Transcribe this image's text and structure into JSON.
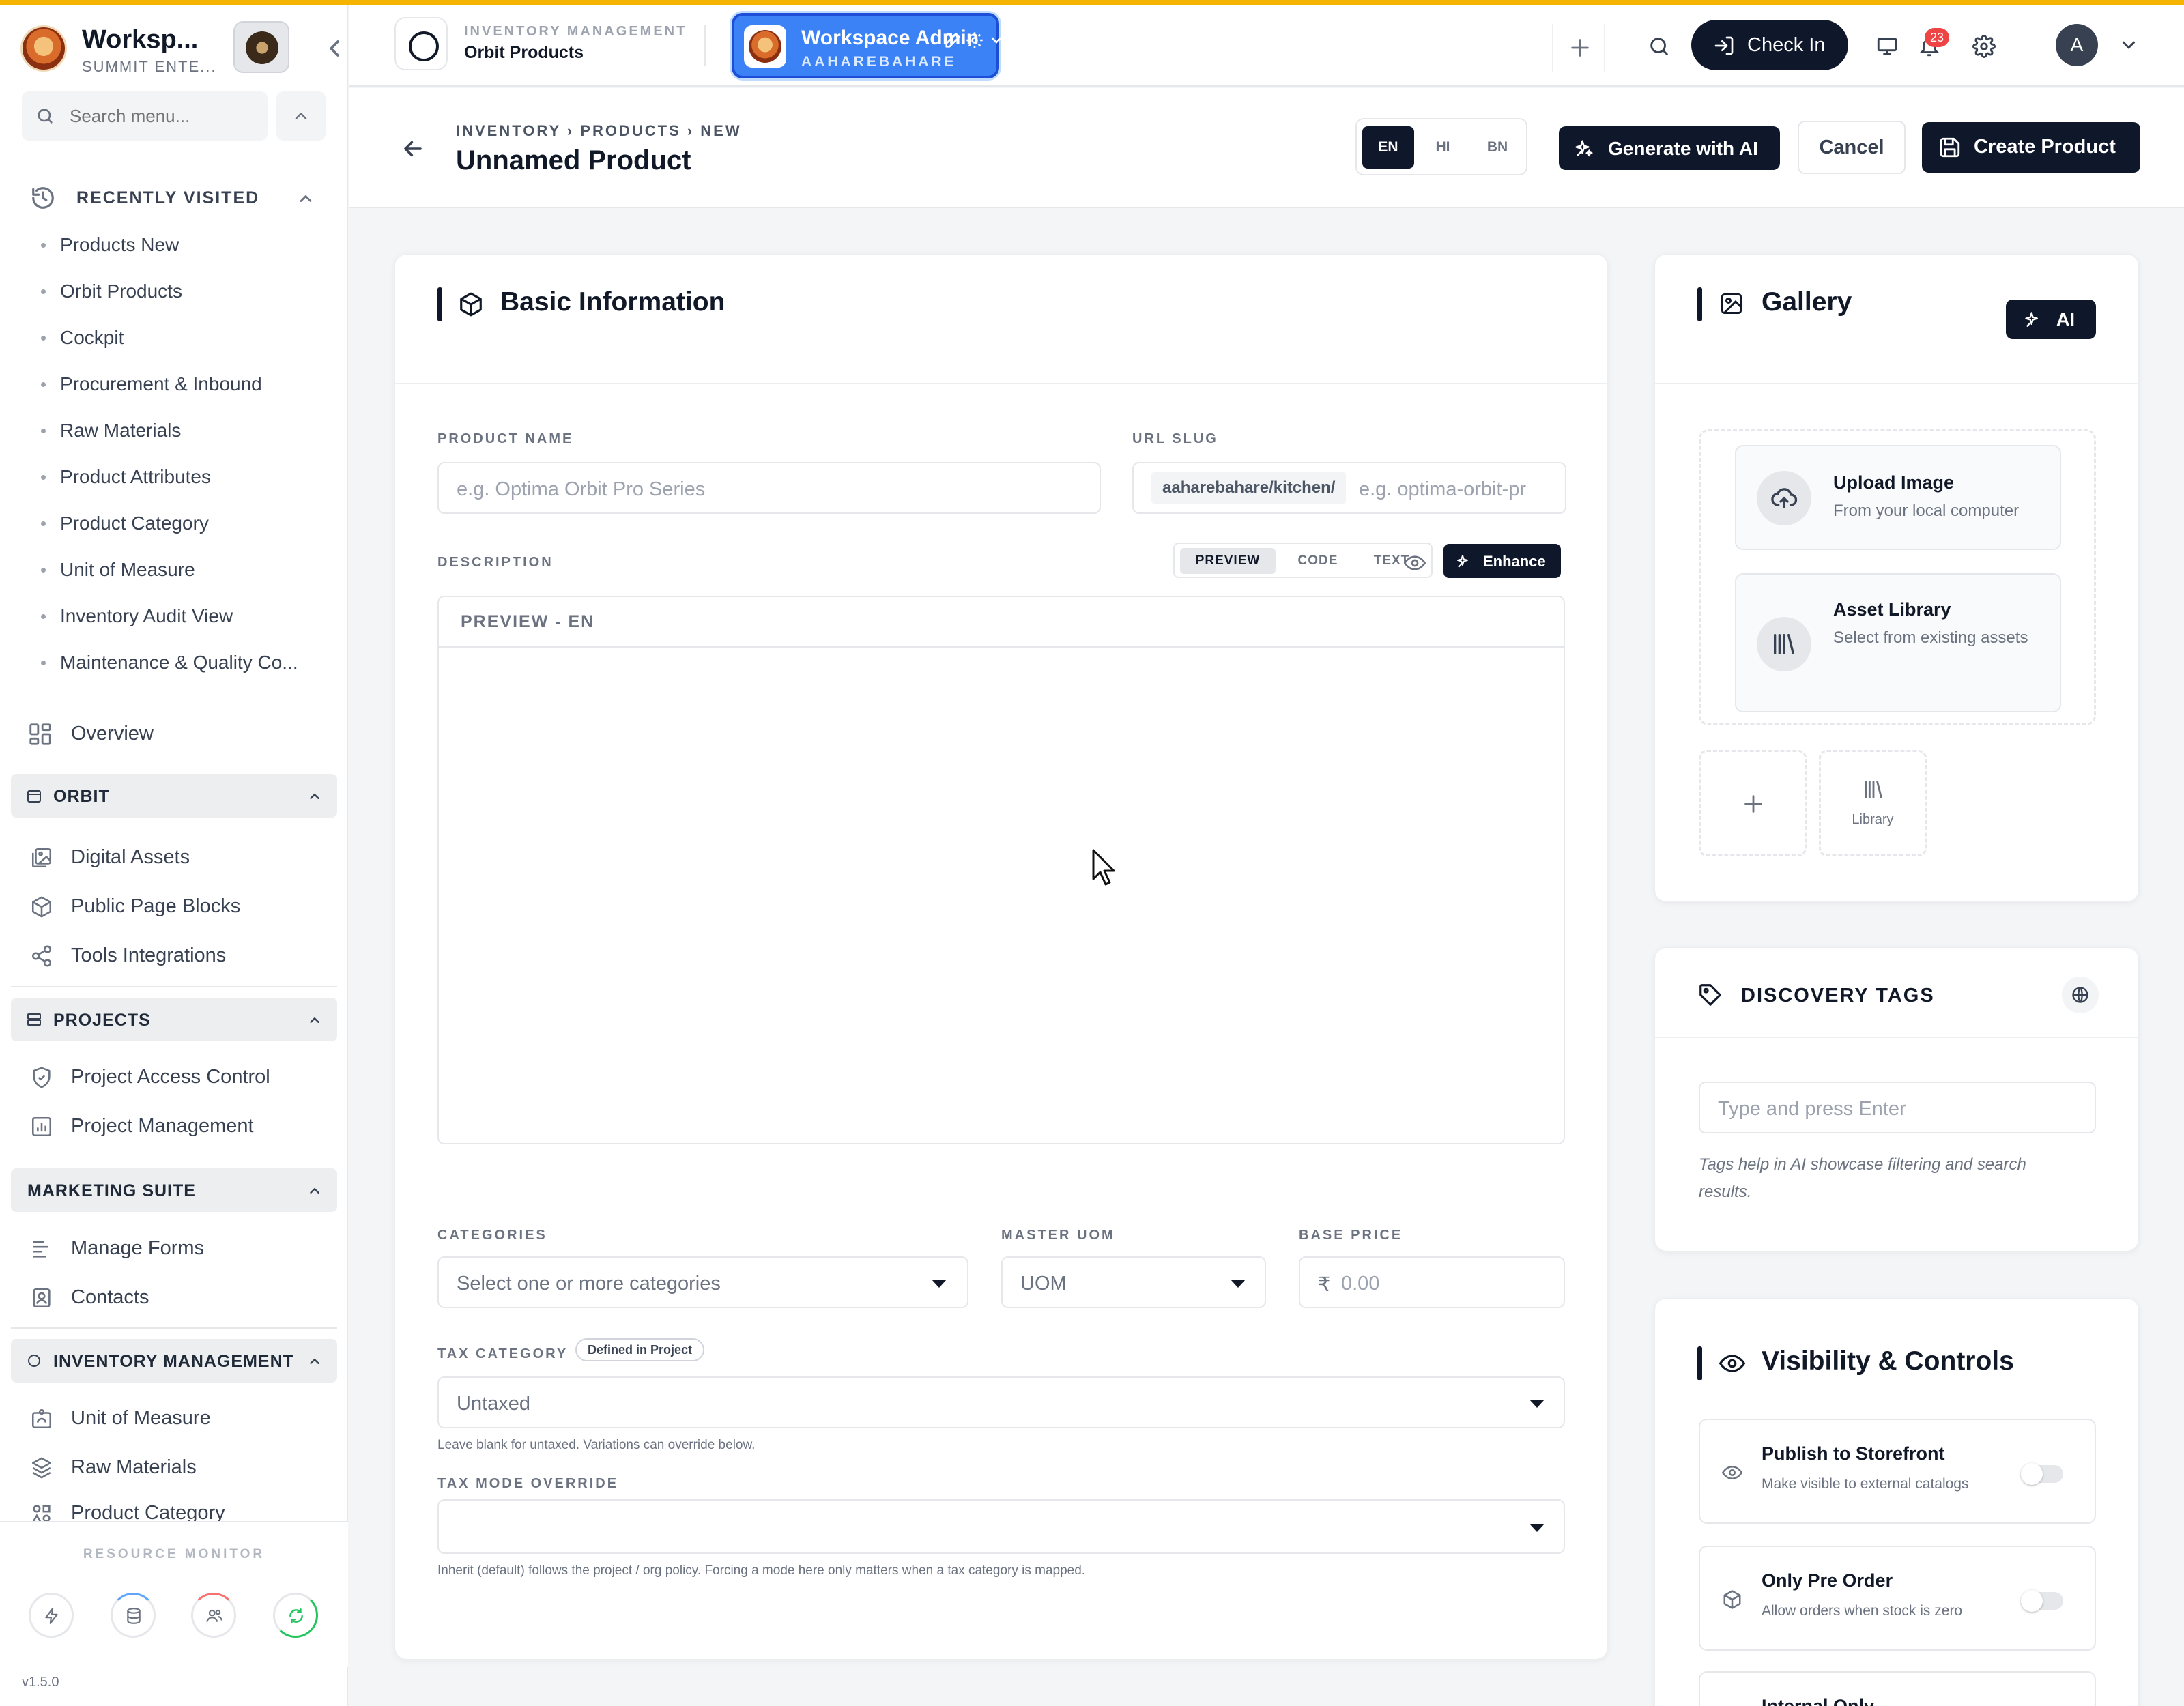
{
  "sidebar": {
    "workspace_name": "Worksp...",
    "workspace_sub": "SUMMIT ENTE...",
    "search_placeholder": "Search menu...",
    "recently_visited": {
      "label": "RECENTLY VISITED",
      "items": [
        "Products New",
        "Orbit Products",
        "Cockpit",
        "Procurement & Inbound",
        "Raw Materials",
        "Product Attributes",
        "Product Category",
        "Unit of Measure",
        "Inventory Audit View",
        "Maintenance & Quality Co..."
      ]
    },
    "overview_label": "Overview",
    "groups": {
      "orbit": {
        "label": "ORBIT",
        "items": [
          "Digital Assets",
          "Public Page Blocks",
          "Tools Integrations"
        ]
      },
      "projects": {
        "label": "PROJECTS",
        "items": [
          "Project Access Control",
          "Project Management"
        ]
      },
      "marketing": {
        "label": "MARKETING SUITE",
        "items": [
          "Manage Forms",
          "Contacts"
        ]
      },
      "inventory": {
        "label": "INVENTORY MANAGEMENT",
        "items": [
          "Unit of Measure",
          "Raw Materials",
          "Product Category"
        ]
      }
    },
    "resource_monitor_label": "RESOURCE MONITOR",
    "version": "v1.5.0"
  },
  "topbar": {
    "module_sub": "INVENTORY MANAGEMENT",
    "module_title": "Orbit Products",
    "workspace_switch": {
      "title": "Workspace Admin",
      "subtitle": "AAHAREBAHARE"
    },
    "checkin_label": "Check In",
    "notification_count": "23",
    "user_initial": "A"
  },
  "page": {
    "breadcrumb": "INVENTORY › PRODUCTS › NEW",
    "title": "Unnamed Product",
    "languages": [
      "EN",
      "HI",
      "BN"
    ],
    "active_language": "EN",
    "generate_ai_label": "Generate with AI",
    "cancel_label": "Cancel",
    "create_label": "Create Product"
  },
  "basic_info": {
    "title": "Basic Information",
    "product_name_label": "PRODUCT NAME",
    "product_name_placeholder": "e.g. Optima Orbit Pro Series",
    "url_slug_label": "URL SLUG",
    "url_slug_prefix": "aaharebahare/kitchen/",
    "url_slug_placeholder": "e.g. optima-orbit-pr",
    "description_label": "DESCRIPTION",
    "description_tabs": [
      "PREVIEW",
      "CODE",
      "TEXT"
    ],
    "active_description_tab": "PREVIEW",
    "enhance_label": "Enhance",
    "preview_header": "PREVIEW - EN",
    "categories_label": "CATEGORIES",
    "categories_placeholder": "Select one or more categories",
    "master_uom_label": "MASTER UOM",
    "master_uom_placeholder": "UOM",
    "base_price_label": "BASE PRICE",
    "currency_symbol": "₹",
    "base_price_placeholder": "0.00",
    "tax_category_label": "TAX CATEGORY",
    "tax_category_pill": "Defined in Project",
    "tax_category_value": "Untaxed",
    "tax_category_hint": "Leave blank for untaxed. Variations can override below.",
    "tax_mode_label": "TAX MODE OVERRIDE",
    "tax_mode_value": "",
    "tax_mode_hint": "Inherit (default) follows the project / org policy. Forcing a mode here only matters when a tax category is mapped."
  },
  "gallery": {
    "title": "Gallery",
    "ai_label": "AI",
    "upload_title": "Upload Image",
    "upload_sub": "From your local computer",
    "library_title": "Asset Library",
    "library_sub": "Select from existing assets",
    "library_tile_label": "Library"
  },
  "discovery_tags": {
    "title": "DISCOVERY TAGS",
    "placeholder": "Type and press Enter",
    "note": "Tags help in AI showcase filtering and search results."
  },
  "visibility": {
    "title": "Visibility & Controls",
    "rows": [
      {
        "title": "Publish to Storefront",
        "sub": "Make visible to external catalogs",
        "on": false
      },
      {
        "title": "Only Pre Order",
        "sub": "Allow orders when stock is zero",
        "on": false
      },
      {
        "title": "Internal Only",
        "sub": "",
        "on": false
      }
    ]
  }
}
